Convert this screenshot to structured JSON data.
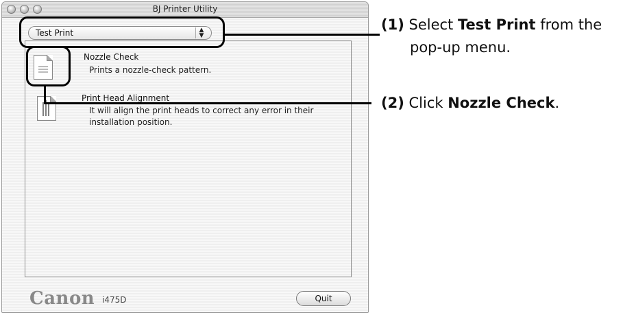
{
  "window": {
    "title": "BJ Printer Utility"
  },
  "popup": {
    "selected": "Test Print"
  },
  "items": [
    {
      "title": "Nozzle Check",
      "description": "Prints a nozzle-check pattern."
    },
    {
      "title": "Print Head Alignment",
      "description": "It will align the print heads to correct any error in their installation position."
    }
  ],
  "footer": {
    "brand": "Canon",
    "model": "i475D",
    "quit_label": "Quit"
  },
  "callouts": [
    {
      "number": "(1)",
      "prefix": "Select ",
      "bold": "Test Print",
      "suffix": " from the",
      "line2": "pop-up menu."
    },
    {
      "number": "(2)",
      "prefix": "Click ",
      "bold": "Nozzle Check",
      "suffix": "."
    }
  ]
}
